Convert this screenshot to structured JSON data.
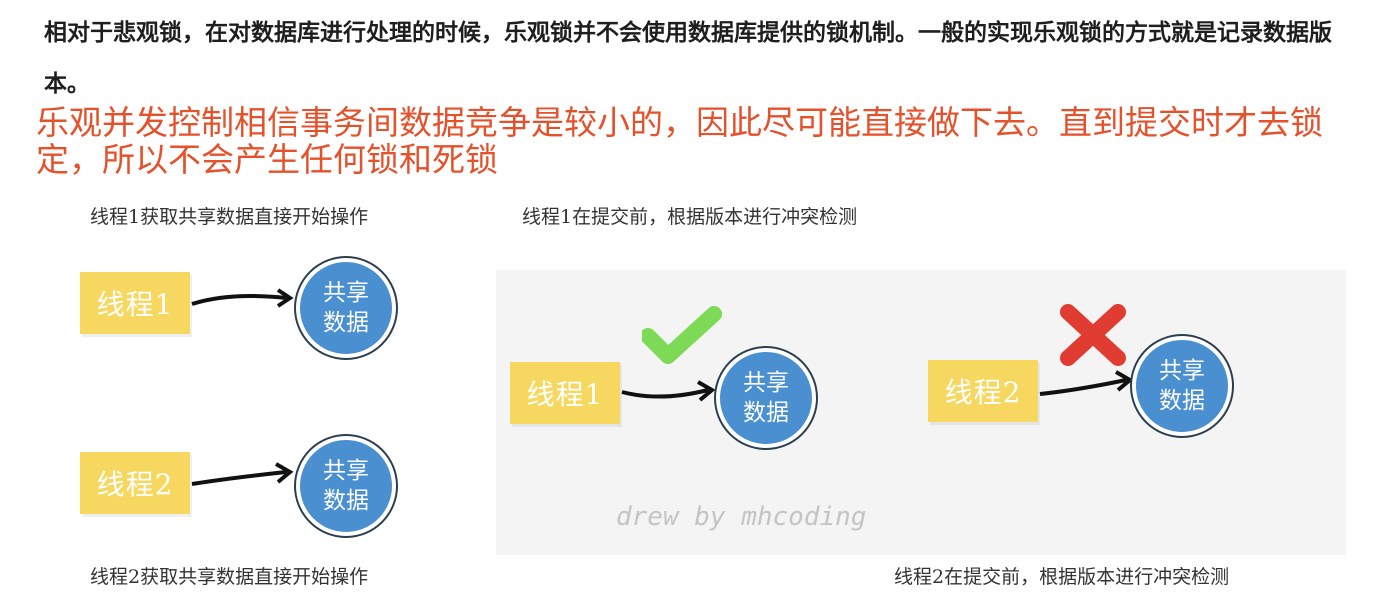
{
  "intro": "相对于悲观锁，在对数据库进行处理的时候，乐观锁并不会使用数据库提供的锁机制。一般的实现乐观锁的方式就是记录数据版本。",
  "callout": "乐观并发控制相信事务间数据竞争是较小的，因此尽可能直接做下去。直到提交时才去锁定，所以不会产生任何锁和死锁",
  "diagram": {
    "caption_top_left": "线程1获取共享数据直接开始操作",
    "caption_top_right": "线程1在提交前，根据版本进行冲突检测",
    "caption_bottom_left": "线程2获取共享数据直接开始操作",
    "caption_bottom_right": "线程2在提交前，根据版本进行冲突检测",
    "thread1": "线程1",
    "thread2": "线程2",
    "shared_line1": "共享",
    "shared_line2": "数据",
    "watermark": "drew by mhcoding",
    "check_color": "#7ed957",
    "cross_color": "#e03c31",
    "thread_color": "#f6d860",
    "data_color": "#4a8fcf"
  }
}
